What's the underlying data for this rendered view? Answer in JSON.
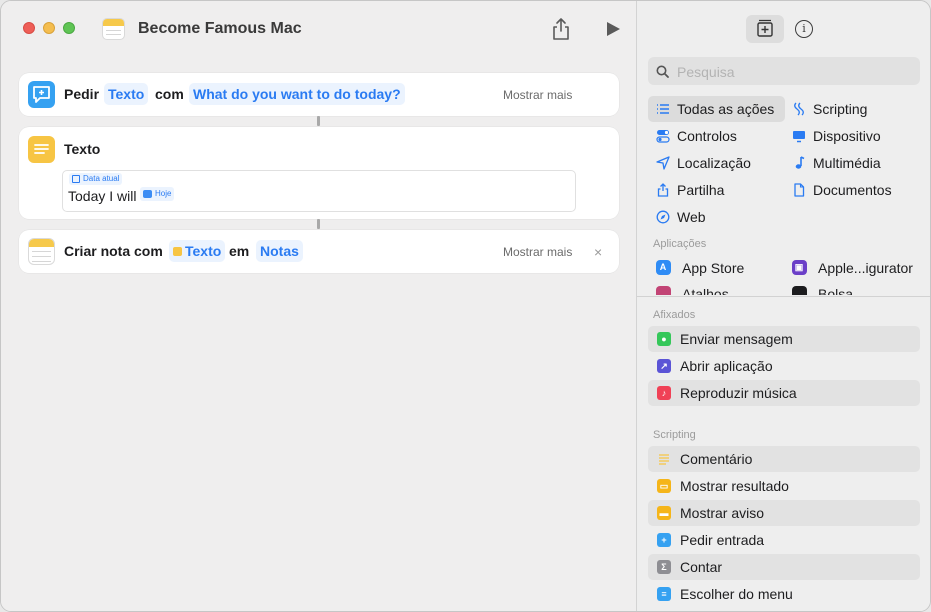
{
  "window": {
    "title": "Become Famous Mac"
  },
  "workflow": {
    "ask": {
      "verb": "Pedir",
      "type_token": "Texto",
      "with_label": "com",
      "prompt_token": "What do you want to do today?",
      "more": "Mostrar mais"
    },
    "text": {
      "title": "Texto",
      "date_label": "Data atual",
      "content": "Today I will",
      "date_token": "Hoje"
    },
    "note": {
      "verb": "Criar nota com",
      "var_token": "Texto",
      "in_label": "em",
      "target_token": "Notas",
      "more": "Mostrar mais",
      "close": "×"
    }
  },
  "library": {
    "info": "i",
    "search_placeholder": "Pesquisa",
    "categories": [
      {
        "label": "Todas as ações",
        "icon": "list-icon",
        "selected": true
      },
      {
        "label": "Scripting",
        "icon": "scripting-icon"
      },
      {
        "label": "Controlos",
        "icon": "toggle-icon"
      },
      {
        "label": "Dispositivo",
        "icon": "monitor-icon"
      },
      {
        "label": "Localização",
        "icon": "location-arrow-icon"
      },
      {
        "label": "Multimédia",
        "icon": "music-note-icon"
      },
      {
        "label": "Partilha",
        "icon": "share-icon"
      },
      {
        "label": "Documentos",
        "icon": "document-icon"
      },
      {
        "label": "Web",
        "icon": "compass-icon"
      }
    ],
    "apps_label": "Aplicações",
    "apps": [
      {
        "label": "App Store",
        "icon": "app-store-icon",
        "color": "#2f8cf5"
      },
      {
        "label": "Apple...igurator",
        "icon": "apple-configurator-icon",
        "color": "#6b3fc8"
      },
      {
        "label": "Atalhos",
        "icon": "shortcuts-icon",
        "color": "#c24475"
      },
      {
        "label": "Bolsa",
        "icon": "stocks-icon",
        "color": "#1c1c1e"
      }
    ],
    "pinned_label": "Afixados",
    "pinned": [
      {
        "label": "Enviar mensagem",
        "icon": "message-icon",
        "color": "#35c75a"
      },
      {
        "label": "Abrir aplicação",
        "icon": "open-app-icon",
        "color": "#5b54d6"
      },
      {
        "label": "Reproduzir música",
        "icon": "play-music-icon",
        "color": "#f04156"
      }
    ],
    "scripting_label": "Scripting",
    "scripting": [
      {
        "label": "Comentário",
        "icon": "comment-lines-icon",
        "color": "#f7c544"
      },
      {
        "label": "Mostrar resultado",
        "icon": "show-result-icon",
        "color": "#f5b519"
      },
      {
        "label": "Mostrar aviso",
        "icon": "show-alert-icon",
        "color": "#f5b519"
      },
      {
        "label": "Pedir entrada",
        "icon": "ask-input-icon",
        "color": "#35a1f1"
      },
      {
        "label": "Contar",
        "icon": "sigma-icon",
        "color": "#8e8e93"
      },
      {
        "label": "Escolher do menu",
        "icon": "menu-choose-icon",
        "color": "#35a1f1"
      }
    ]
  }
}
